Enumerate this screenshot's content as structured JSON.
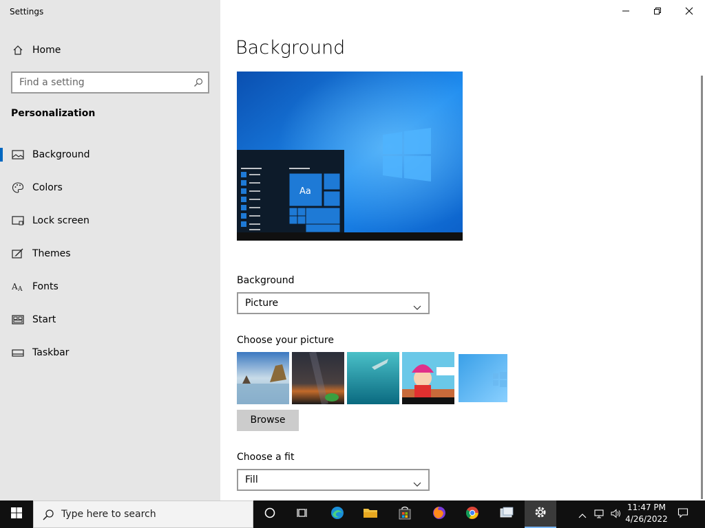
{
  "window": {
    "title": "Settings",
    "controls": [
      "minimize-icon",
      "restore-icon",
      "close-icon"
    ]
  },
  "sidebar": {
    "home_label": "Home",
    "search_placeholder": "Find a setting",
    "section_title": "Personalization",
    "items": [
      {
        "label": "Background",
        "icon": "picture-icon",
        "active": true
      },
      {
        "label": "Colors",
        "icon": "palette-icon"
      },
      {
        "label": "Lock screen",
        "icon": "lock-screen-icon"
      },
      {
        "label": "Themes",
        "icon": "themes-icon"
      },
      {
        "label": "Fonts",
        "icon": "fonts-icon"
      },
      {
        "label": "Start",
        "icon": "start-icon"
      },
      {
        "label": "Taskbar",
        "icon": "taskbar-icon"
      }
    ]
  },
  "main": {
    "title": "Background",
    "preview": {
      "sample_text": "Aa"
    },
    "background_label": "Background",
    "background_value": "Picture",
    "choose_picture_label": "Choose your picture",
    "browse_label": "Browse",
    "choose_fit_label": "Choose a fit",
    "fit_value": "Fill"
  },
  "taskbar": {
    "search_placeholder": "Type here to search",
    "time": "11:47 PM",
    "date": "4/26/2022",
    "apps": [
      "cortana-icon",
      "task-view-icon",
      "edge-icon",
      "file-explorer-icon",
      "store-icon",
      "firefox-icon",
      "chrome-icon",
      "app-icon",
      "settings-icon"
    ]
  },
  "colors": {
    "accent": "#0067c0",
    "sidebar_bg": "#e6e6e6",
    "taskbar_bg": "#101010"
  }
}
